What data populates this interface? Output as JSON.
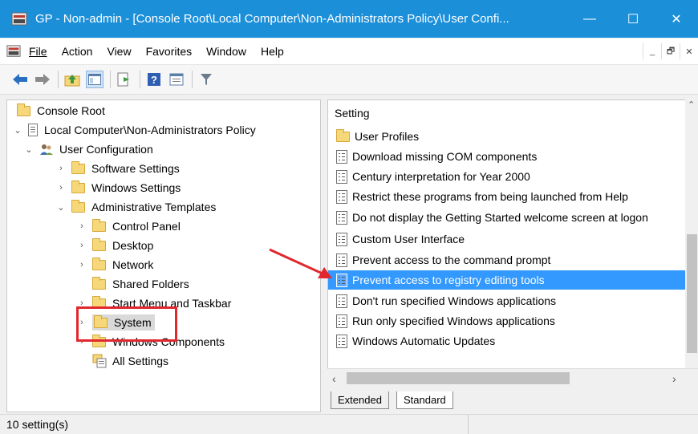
{
  "window": {
    "title": "GP - Non-admin - [Console Root\\Local Computer\\Non-Administrators Policy\\User Confi...",
    "minimize": "—",
    "maximize": "☐",
    "close": "✕"
  },
  "menu": {
    "file": "File",
    "action": "Action",
    "view": "View",
    "favorites": "Favorites",
    "window": "Window",
    "help": "Help"
  },
  "mdi": {
    "min": "_",
    "restore": "🗗",
    "close": "✕"
  },
  "tree": {
    "console_root": "Console Root",
    "policy": "Local Computer\\Non-Administrators Policy",
    "user_config": "User Configuration",
    "software_settings": "Software Settings",
    "windows_settings": "Windows Settings",
    "admin_templates": "Administrative Templates",
    "control_panel": "Control Panel",
    "desktop": "Desktop",
    "network": "Network",
    "shared_folders": "Shared Folders",
    "start_menu": "Start Menu and Taskbar",
    "system": "System",
    "windows_components": "Windows Components",
    "all_settings": "All Settings"
  },
  "list": {
    "header": "Setting",
    "items": [
      {
        "label": "User Profiles",
        "icon": "folder"
      },
      {
        "label": "Download missing COM components",
        "icon": "setting"
      },
      {
        "label": "Century interpretation for Year 2000",
        "icon": "setting"
      },
      {
        "label": "Restrict these programs from being launched from Help",
        "icon": "setting"
      },
      {
        "label": "Do not display the Getting Started welcome screen at logon",
        "icon": "setting"
      },
      {
        "label": "Custom User Interface",
        "icon": "setting"
      },
      {
        "label": "Prevent access to the command prompt",
        "icon": "setting"
      },
      {
        "label": "Prevent access to registry editing tools",
        "icon": "setting",
        "selected": true
      },
      {
        "label": "Don't run specified Windows applications",
        "icon": "setting"
      },
      {
        "label": "Run only specified Windows applications",
        "icon": "setting"
      },
      {
        "label": "Windows Automatic Updates",
        "icon": "setting"
      }
    ]
  },
  "tabs": {
    "extended": "Extended",
    "standard": "Standard"
  },
  "status": {
    "text": "10 setting(s)"
  },
  "colors": {
    "titlebar": "#1c8fd9",
    "selection": "#3399ff",
    "annotation": "#e0282e"
  }
}
